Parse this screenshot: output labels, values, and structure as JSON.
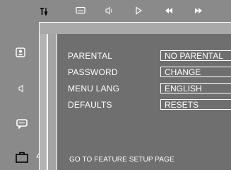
{
  "toolbar": {
    "icons": [
      "setup-icon",
      "subtitle-icon",
      "audio-icon",
      "play-icon",
      "rewind-icon",
      "fast-forward-icon"
    ]
  },
  "sidebar": {
    "items": [
      {
        "icon": "user-icon",
        "name": "parental"
      },
      {
        "icon": "speaker-icon",
        "name": "audio"
      },
      {
        "icon": "subtitle-bubble-icon",
        "name": "subtitle"
      },
      {
        "icon": "briefcase-icon",
        "name": "feature"
      }
    ]
  },
  "menu": {
    "items": [
      {
        "label": "PARENTAL",
        "value": "NO PARENTAL"
      },
      {
        "label": "PASSWORD",
        "value": "CHANGE"
      },
      {
        "label": "MENU LANG",
        "value": "ENGLISH"
      },
      {
        "label": "DEFAULTS",
        "value": "RESETS"
      }
    ]
  },
  "status": {
    "text": "GO TO FEATURE SETUP PAGE"
  },
  "colors": {
    "panel": "#8a8a8a",
    "main": "#6f6f6f",
    "text": "#ffffff"
  }
}
